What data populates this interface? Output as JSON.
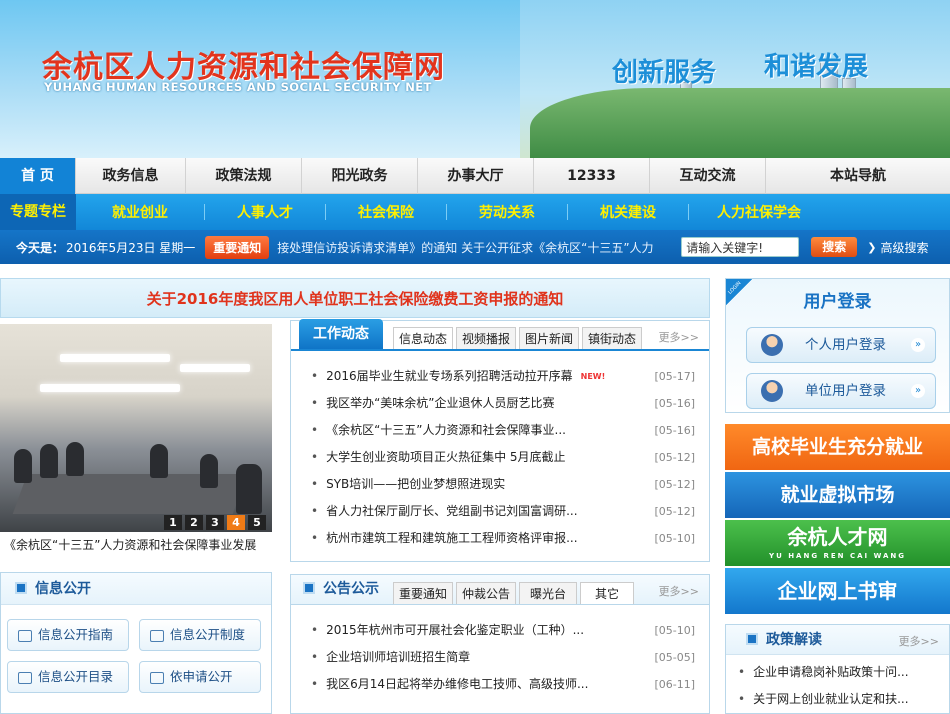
{
  "header": {
    "title": "余杭区人力资源和社会保障网",
    "subtitle": "YUHANG HUMAN RESOURCES AND SOCIAL SECURITY NET",
    "slogan_left": "创新服务",
    "slogan_right": "和谐发展"
  },
  "nav": {
    "items": [
      "首 页",
      "政务信息",
      "政策法规",
      "阳光政务",
      "办事大厅",
      "12333",
      "互动交流",
      "本站导航"
    ]
  },
  "subnav": {
    "lead": "专题专栏",
    "items": [
      "就业创业",
      "人事人才",
      "社会保险",
      "劳动关系",
      "机关建设",
      "人力社保学会"
    ]
  },
  "infobar": {
    "today_label": "今天是：",
    "date": "2016年5月23日 星期一",
    "badge": "重要通知",
    "marquee": "接处理信访投诉请求清单》的通知  关于公开征求《余杭区“十三五”人力",
    "search_placeholder": "请输入关键字!",
    "search_button": "搜索",
    "advanced": "高级搜索"
  },
  "notice": "关于2016年度我区用人单位职工社会保险缴费工资申报的通知",
  "slideshow": {
    "caption": "《余杭区“十三五”人力资源和社会保障事业发展",
    "pages": [
      "1",
      "2",
      "3",
      "4",
      "5"
    ],
    "active_page": "4"
  },
  "work": {
    "head": "工作动态",
    "tabs": [
      "信息动态",
      "视频播报",
      "图片新闻",
      "镇街动态"
    ],
    "more": "更多>>",
    "new_tag": "NEW!",
    "items": [
      {
        "title": "2016届毕业生就业专场系列招聘活动拉开序幕",
        "date": "[05-17]"
      },
      {
        "title": "我区举办“美味余杭”企业退休人员厨艺比赛",
        "date": "[05-16]"
      },
      {
        "title": "《余杭区“十三五”人力资源和社会保障事业...",
        "date": "[05-16]"
      },
      {
        "title": "大学生创业资助项目正火热征集中 5月底截止",
        "date": "[05-12]"
      },
      {
        "title": "SYB培训——把创业梦想照进现实",
        "date": "[05-12]"
      },
      {
        "title": "省人力社保厅副厅长、党组副书记刘国富调研...",
        "date": "[05-12]"
      },
      {
        "title": "杭州市建筑工程和建筑施工工程师资格评审报...",
        "date": "[05-10]"
      }
    ]
  },
  "announce": {
    "head": "公告公示",
    "tabs": [
      "重要通知",
      "仲裁公告",
      "曝光台",
      "其它"
    ],
    "more": "更多>>",
    "items": [
      {
        "title": "2015年杭州市可开展社会化鉴定职业（工种）...",
        "date": "[05-10]"
      },
      {
        "title": "企业培训师培训班招生简章",
        "date": "[05-05]"
      },
      {
        "title": "我区6月14日起将举办维修电工技师、高级技师...",
        "date": "[06-11]"
      }
    ]
  },
  "info_open": {
    "head": "信息公开",
    "buttons": [
      "信息公开指南",
      "信息公开制度",
      "信息公开目录",
      "依申请公开"
    ]
  },
  "login": {
    "ribbon": "LOGIN",
    "title": "用户登录",
    "personal": "个人用户登录",
    "unit": "单位用户登录"
  },
  "ads": [
    "高校毕业生充分就业",
    "就业虚拟市场",
    "余杭人才网",
    "企业网上书审"
  ],
  "ads_sub": "YU HANG REN CAI WANG",
  "policy": {
    "head": "政策解读",
    "more": "更多>>",
    "items": [
      "企业申请稳岗补贴政策十问...",
      "关于网上创业就业认定和扶..."
    ]
  },
  "colors": {
    "accent": "#1283d6",
    "title_red": "#e2341d",
    "highlight_yellow": "#fff000"
  }
}
